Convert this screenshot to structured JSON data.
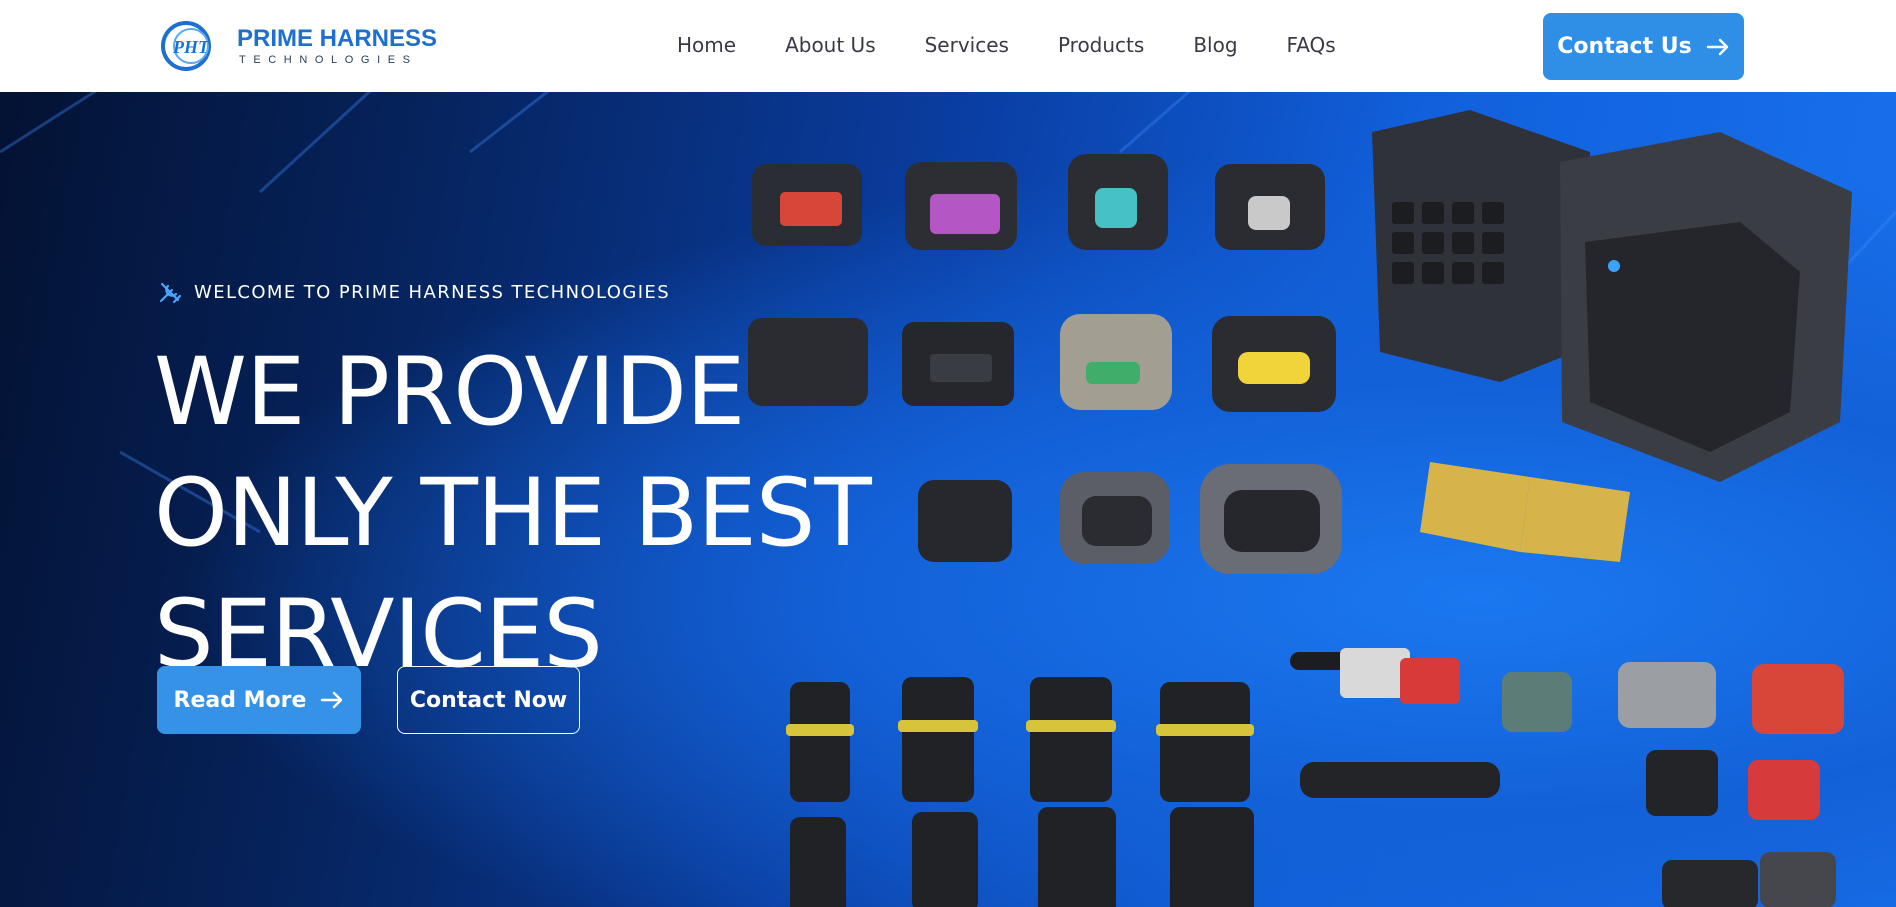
{
  "brand": {
    "mark": "PHT",
    "name": "PRIME HARNESS",
    "tagline": "TECHNOLOGIES",
    "color": "#1f6fd1"
  },
  "nav": {
    "items": [
      {
        "label": "Home"
      },
      {
        "label": "About Us"
      },
      {
        "label": "Services"
      },
      {
        "label": "Products"
      },
      {
        "label": "Blog"
      },
      {
        "label": "FAQs"
      }
    ],
    "cta": {
      "label": "Contact Us",
      "icon": "arrow-right-icon"
    }
  },
  "hero": {
    "eyebrow": {
      "icon": "tools-icon",
      "text": "WELCOME TO PRIME HARNESS TECHNOLOGIES"
    },
    "headline": [
      "WE PROVIDE",
      "ONLY THE BEST",
      "SERVICES"
    ],
    "primary_button": {
      "label": "Read More",
      "icon": "arrow-right-icon"
    },
    "secondary_button": {
      "label": "Contact Now"
    },
    "background_image": "automotive-wire-harness-connectors"
  },
  "colors": {
    "accent": "#2f8fe6",
    "hero_dark": "#041233",
    "hero_bright": "#1a72ee",
    "nav_text": "#3a3a44"
  }
}
